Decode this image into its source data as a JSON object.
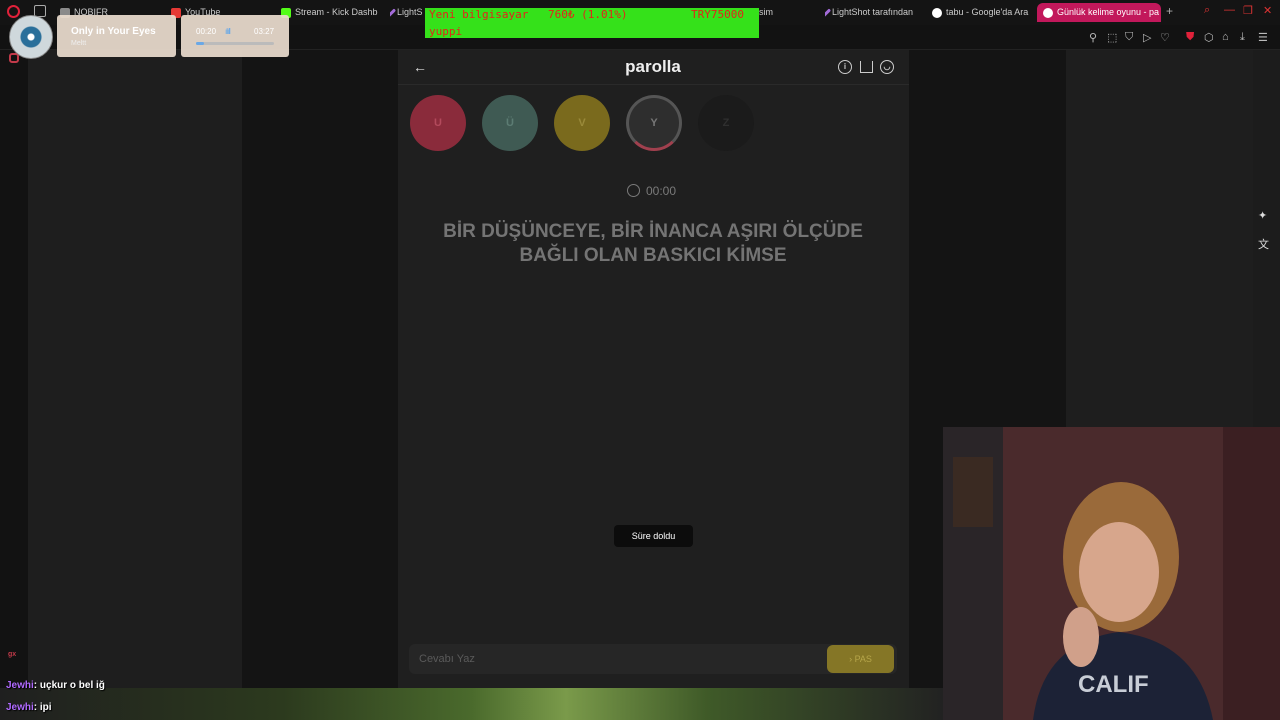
{
  "browser": {
    "tabs": [
      {
        "label": "NOBIFR",
        "color": "#8a8a8a"
      },
      {
        "label": "YouTube",
        "color": "#e53935"
      },
      {
        "label": "Stream - Kick Dashb",
        "color": "#53fc18"
      },
      {
        "label": "LightS",
        "color": "#a36bd9"
      },
      {
        "label": "LightShot tarafından",
        "color": "#a36bd9"
      },
      {
        "label": "tabu - Google'da Ara",
        "color": "#ffffff"
      },
      {
        "label": "Günlük kelime oyunu - pa",
        "color": "#ffffff"
      }
    ],
    "active_tab_index": 6,
    "partial_tab_text": "sim"
  },
  "music": {
    "title": "Only in Your Eyes",
    "artist": "Meltt",
    "elapsed": "00:20",
    "total": "03:27",
    "progress": 0.1
  },
  "banner": {
    "line1_left": "Yeni bilgisayar",
    "line1_mid": "760₺ (1.01%)",
    "line1_right": "TRY75000",
    "line2": "yuppi"
  },
  "app": {
    "title": "parolla",
    "letters": [
      {
        "char": "U",
        "bg": "#8a2b3b",
        "fg": "#b34a5c"
      },
      {
        "char": "Ü",
        "bg": "#3f5a53",
        "fg": "#5c7c73"
      },
      {
        "char": "V",
        "bg": "#7a6a1d",
        "fg": "#9a8a3a"
      },
      {
        "char": "Y",
        "bg": "#2e2e2e",
        "fg": "#777777"
      },
      {
        "char": "Z",
        "bg": "#1b1b1b",
        "fg": "#2f2f2f"
      }
    ],
    "timer": "00:00",
    "question": "BİR DÜŞÜNCEYE, BİR İNANCA AŞIRI ÖLÇÜDE BAĞLI OLAN BASKICI KİMSE",
    "toast": "Süre doldu",
    "answer_placeholder": "Cevabı Yaz",
    "pass_label": "PAS",
    "pass_arrow": "›"
  },
  "chat": [
    {
      "user": "Jewhi",
      "message": ": uçkur o bel iğ"
    },
    {
      "user": "Jewhi",
      "message": ": ipi"
    }
  ],
  "sidebar": {
    "gx_label": "gx"
  },
  "colors": {
    "accent": "#c2185b",
    "banner": "#35e11a",
    "banner_text": "#e2241a",
    "pass_button": "#857626"
  }
}
